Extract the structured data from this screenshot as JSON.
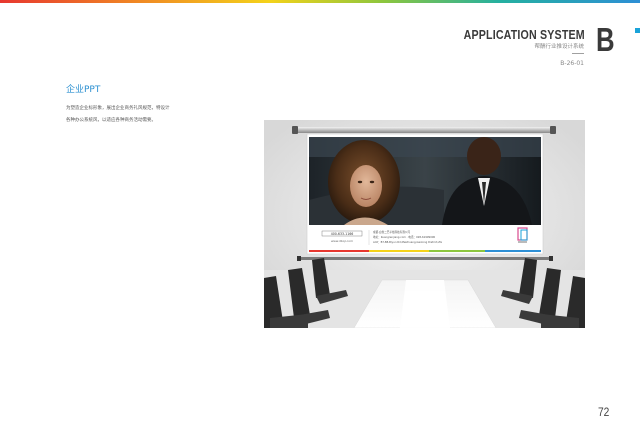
{
  "header": {
    "title": "APPLICATION SYSTEM",
    "subtitle": "帮酬行业推设计系统",
    "code": "B-26-01",
    "letter": "B"
  },
  "section": {
    "title": "企业PPT",
    "lines": [
      "为塑造企业标形象，展出企业商务礼风规范，特设计",
      "各种办公系统风，以适应各种商务活动需要。"
    ]
  },
  "slide": {
    "phone": "400-633-1166",
    "website": "www.dbqr.com",
    "info_lines": [
      "成都·白雀二巴平线科技有限公司",
      "地址：Kuangrenjiang.com · 电话：028-61999090",
      "Add：B7-B8-Biyun Rd,Meizhuang,Gaolong District,ZG"
    ]
  },
  "footer": {
    "page_number": "72"
  },
  "colors": {
    "accent": "#2a8fd0",
    "accent_mark": "#1aa3d9"
  }
}
